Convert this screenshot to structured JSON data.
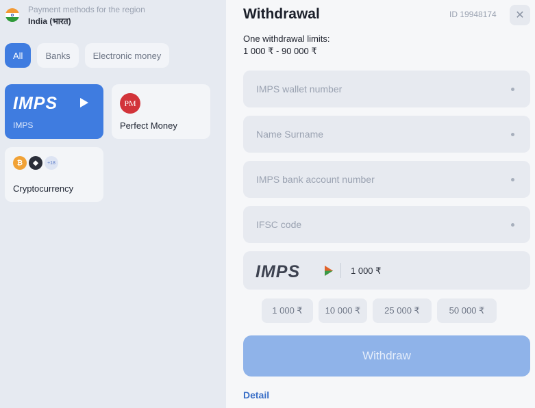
{
  "region": {
    "caption": "Payment methods for the region",
    "name": "India (भारत)"
  },
  "filters": [
    {
      "label": "All",
      "active": true
    },
    {
      "label": "Banks",
      "active": false
    },
    {
      "label": "Electronic money",
      "active": false
    }
  ],
  "methods": [
    {
      "label": "IMPS",
      "logo_text": "IMPS",
      "selected": true
    },
    {
      "label": "Perfect Money",
      "logo_text": "PM",
      "selected": false
    },
    {
      "label": "Cryptocurrency",
      "extra_count": "+18",
      "selected": false
    }
  ],
  "withdrawal": {
    "title": "Withdrawal",
    "user_id": "ID 19948174",
    "limits_label": "One withdrawal limits:",
    "limits_value": "1 000 ₹ - 90 000 ₹",
    "fields": [
      {
        "placeholder": "IMPS wallet number"
      },
      {
        "placeholder": "Name Surname"
      },
      {
        "placeholder": "IMPS bank account number"
      },
      {
        "placeholder": "IFSC code"
      }
    ],
    "amount": "1 000 ₹",
    "presets": [
      "1 000 ₹",
      "10 000 ₹",
      "25 000 ₹",
      "50 000 ₹"
    ],
    "submit_label": "Withdraw",
    "detail_link": "Detail"
  },
  "colors": {
    "accent": "#3f7ce0",
    "button_disabled": "#8fb3e9",
    "link": "#3a6fc7"
  },
  "icons": {
    "close": "close-icon",
    "flag": "india-flag-icon"
  }
}
